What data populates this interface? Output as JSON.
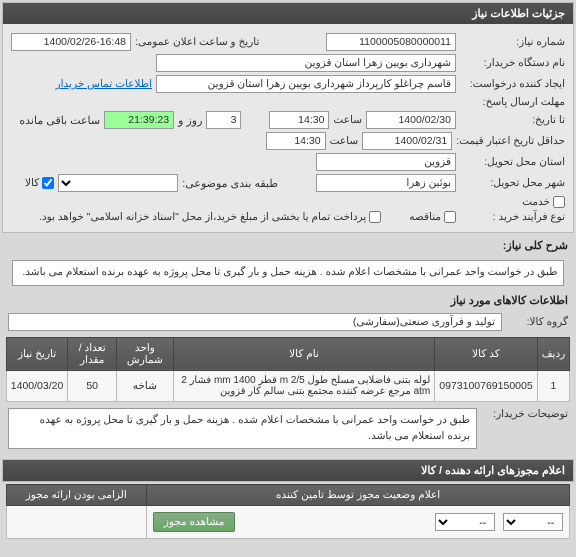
{
  "panels": {
    "details_title": "جزئیات اطلاعات نیاز",
    "contact_title": "اطلاعات تماس خریدار"
  },
  "labels": {
    "need_no": "شماره نیاز:",
    "announce_dt": "تاریخ و ساعت اعلان عمومی:",
    "buyer_org": "نام دستگاه خریدار:",
    "creator": "ایجاد کننده درخواست:",
    "reply_deadline": "مهلت ارسال پاسخ:",
    "to_date": "تا تاریخ:",
    "price_valid": "حداقل تاریخ اعتبار قیمت:",
    "delivery_province": "استان محل تحویل:",
    "delivery_city": "شهر محل تحویل:",
    "subject_class": "طبقه بندی موضوعی:",
    "process_type": "نوع فرآیند خرید :",
    "hour": "ساعت",
    "day": "روز و",
    "remaining": "ساعت باقی مانده",
    "goods": "کالا",
    "service": "خدمت",
    "demand": "مناقصه",
    "partial": "پرداخت تمام یا بخشی از مبلغ خرید،از محل \"اسناد خزانه اسلامی\" خواهد بود.",
    "overall_desc": "شرح کلی نیاز:",
    "goods_info": "اطلاعات کالاهای مورد نیاز",
    "goods_group": "گروه کالا:",
    "buyer_desc": "توضیحات خریدار:",
    "license_header": "اعلام مجوزهای ارائه دهنده / کالا",
    "status_header": "اعلام وضعیت مجوز توسط تامین کننده",
    "mandatory": "الزامی بودن ارائه مجوز",
    "view_license": "مشاهده مجوز"
  },
  "fields": {
    "need_no": "1100005080000011",
    "announce_date": "1400/02/26",
    "announce_time": "16:48",
    "buyer_org": "شهرداری بویین زهرا استان قزوین",
    "creator": "قاسم چراغلو کارپرداز شهرداری بویین زهرا استان قزوین",
    "reply_date": "1400/02/30",
    "reply_time": "14:30",
    "days": "3",
    "countdown": "21:39:23",
    "price_valid_date": "1400/02/31",
    "price_valid_time": "14:30",
    "province": "قزوین",
    "city": "بوئین زهرا",
    "subject_select": "",
    "overall_desc": "طبق در خواست واحد عمرانی با مشخصات اعلام شده . هزینه حمل و بار گیری تا محل پروژه به عهده برنده استعلام می باشد.",
    "goods_group": "تولید و فرآوری صنعتی(سفارشی)",
    "buyer_desc": "طبق در خواست واحد عمرانی با مشخصات اعلام شده . هزینه حمل و بار گیری تا محل پروژه به عهده برنده استعلام می باشد."
  },
  "checks": {
    "goods": true,
    "service": false,
    "demand": false,
    "partial": false
  },
  "table": {
    "head": [
      "ردیف",
      "کد کالا",
      "نام کالا",
      "واحد شمارش",
      "تعداد / مقدار",
      "تاریخ نیاز"
    ],
    "rows": [
      [
        "1",
        "0973100769150005",
        "لوله بتنی فاضلابی مسلح طول 2/5 m قطر 1400 mm فشار 2 atm مرجع عرضه کننده مجتمع بتنی سالم کار قزوین",
        "شاخه",
        "50",
        "1400/03/20"
      ]
    ]
  },
  "footer": {
    "select1": "--",
    "select2": "--"
  }
}
